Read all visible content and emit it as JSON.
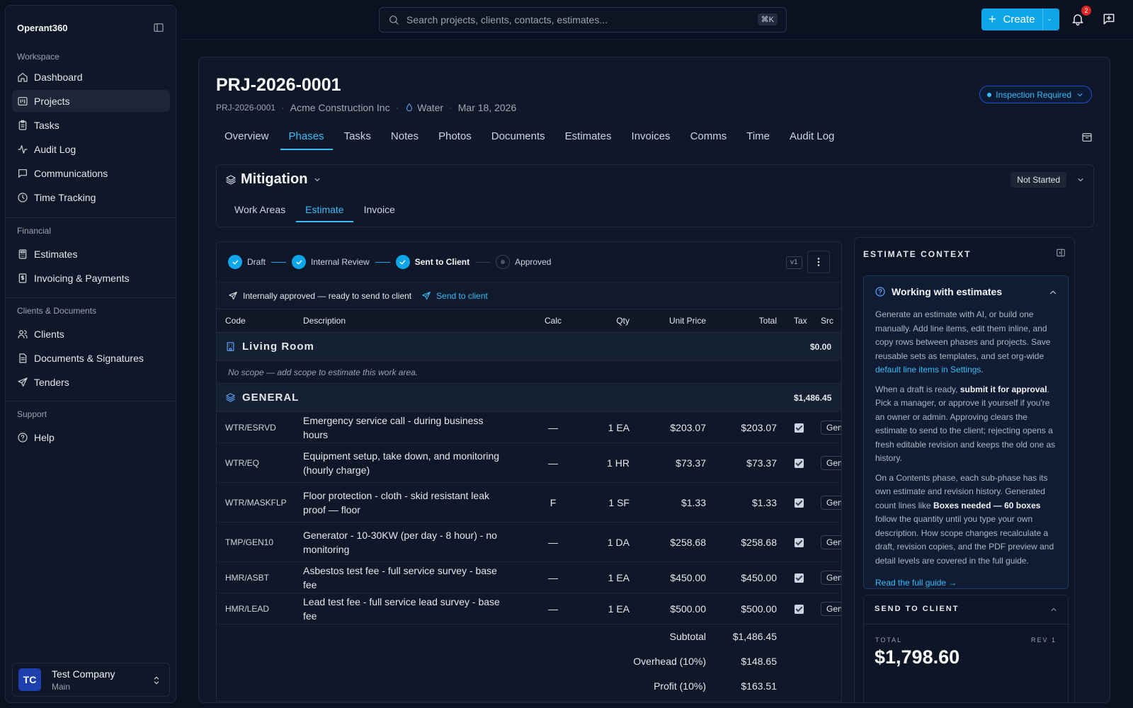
{
  "sidebar": {
    "brand": "Operant360",
    "groups": [
      {
        "label": "Workspace",
        "items": [
          {
            "label": "Dashboard",
            "icon": "home-icon"
          },
          {
            "label": "Projects",
            "icon": "projects-icon",
            "active": true
          },
          {
            "label": "Tasks",
            "icon": "clipboard-icon"
          },
          {
            "label": "Audit Log",
            "icon": "activity-icon"
          },
          {
            "label": "Communications",
            "icon": "message-icon"
          },
          {
            "label": "Time Tracking",
            "icon": "clock-icon"
          }
        ]
      },
      {
        "label": "Financial",
        "items": [
          {
            "label": "Estimates",
            "icon": "calculator-icon"
          },
          {
            "label": "Invoicing & Payments",
            "icon": "receipt-icon"
          }
        ]
      },
      {
        "label": "Clients & Documents",
        "items": [
          {
            "label": "Clients",
            "icon": "users-icon"
          },
          {
            "label": "Documents & Signatures",
            "icon": "file-icon"
          },
          {
            "label": "Tenders",
            "icon": "send-icon"
          }
        ]
      },
      {
        "label": "Support",
        "items": [
          {
            "label": "Help",
            "icon": "help-icon"
          }
        ]
      }
    ],
    "user": {
      "initials": "TC",
      "name": "Test Company",
      "sub": "Main"
    }
  },
  "topbar": {
    "search_placeholder": "Search projects, clients, contacts, estimates...",
    "shortcut": "⌘K",
    "create_label": "Create",
    "notification_count": "2"
  },
  "project": {
    "title": "PRJ-2026-0001",
    "code": "PRJ-2026-0001",
    "client": "Acme Construction Inc",
    "type": "Water",
    "date": "Mar 18, 2026",
    "status": "Inspection Required",
    "tabs": [
      "Overview",
      "Phases",
      "Tasks",
      "Notes",
      "Photos",
      "Documents",
      "Estimates",
      "Invoices",
      "Comms",
      "Time",
      "Audit Log"
    ],
    "active_tab": "Phases"
  },
  "phase": {
    "name": "Mitigation",
    "status": "Not Started",
    "subtabs": [
      "Work Areas",
      "Estimate",
      "Invoice"
    ],
    "active_subtab": "Estimate"
  },
  "estimate": {
    "steps": [
      {
        "label": "Draft",
        "state": "done"
      },
      {
        "label": "Internal Review",
        "state": "done"
      },
      {
        "label": "Sent to Client",
        "state": "current"
      },
      {
        "label": "Approved",
        "state": "pending"
      }
    ],
    "version": "v1",
    "notice": "Internally approved — ready to send to client",
    "notice_action": "Send to client",
    "columns": [
      "Code",
      "Description",
      "Calc",
      "Qty",
      "Unit Price",
      "Total",
      "Tax",
      "Src"
    ],
    "groups": [
      {
        "name": "Living Room",
        "total": "$0.00",
        "empty_text": "No scope — add scope to estimate this work area.",
        "lines": []
      },
      {
        "name": "GENERAL",
        "total": "$1,486.45",
        "lines": [
          {
            "code": "WTR/ESRVD",
            "desc": "Emergency service call - during business hours",
            "calc": "—",
            "qty": "1 EA",
            "unit": "$203.07",
            "total": "$203.07",
            "src": "General"
          },
          {
            "code": "WTR/EQ",
            "desc": "Equipment setup, take down, and monitoring (hourly charge)",
            "calc": "—",
            "qty": "1 HR",
            "unit": "$73.37",
            "total": "$73.37",
            "src": "General"
          },
          {
            "code": "WTR/MASKFLP",
            "desc": "Floor protection - cloth - skid resistant leak proof — floor",
            "calc": "F",
            "qty": "1 SF",
            "unit": "$1.33",
            "total": "$1.33",
            "src": "General"
          },
          {
            "code": "TMP/GEN10",
            "desc": "Generator - 10-30KW (per day - 8 hour) - no monitoring",
            "calc": "—",
            "qty": "1 DA",
            "unit": "$258.68",
            "total": "$258.68",
            "src": "General"
          },
          {
            "code": "HMR/ASBT",
            "desc": "Asbestos test fee - full service survey - base fee",
            "calc": "—",
            "qty": "1 EA",
            "unit": "$450.00",
            "total": "$450.00",
            "src": "General"
          },
          {
            "code": "HMR/LEAD",
            "desc": "Lead test fee - full service lead survey - base fee",
            "calc": "—",
            "qty": "1 EA",
            "unit": "$500.00",
            "total": "$500.00",
            "src": "General"
          }
        ]
      }
    ],
    "summary": [
      {
        "label": "Subtotal",
        "value": "$1,486.45"
      },
      {
        "label": "Overhead (10%)",
        "value": "$148.65"
      },
      {
        "label": "Profit (10%)",
        "value": "$163.51"
      }
    ]
  },
  "context": {
    "heading": "ESTIMATE CONTEXT",
    "guide_title": "Working with estimates",
    "p1_a": "Generate an estimate with AI, or build one manually. Add line items, edit them inline, and copy rows between phases and projects. Save reusable sets as templates, and set org-wide ",
    "p1_link": "default line items in Settings",
    "p1_b": ".",
    "p2_a": "When a draft is ready, ",
    "p2_bold": "submit it for approval",
    "p2_b": ". Pick a manager, or approve it yourself if you're an owner or admin. Approving clears the estimate to send to the client; rejecting opens a fresh editable revision and keeps the old one as history.",
    "p3_a": "On a Contents phase, each sub-phase has its own estimate and revision history. Generated count lines like ",
    "p3_bold": "Boxes needed — 60 boxes",
    "p3_b": " follow the quantity until you type your own description. How scope changes recalculate a draft, revision copies, and the PDF preview and detail levels are covered in the full guide.",
    "read_more": "Read the full guide →",
    "send_heading": "SEND TO CLIENT",
    "total_label": "TOTAL",
    "rev_label": "REV 1",
    "total_value": "$1,798.60"
  }
}
